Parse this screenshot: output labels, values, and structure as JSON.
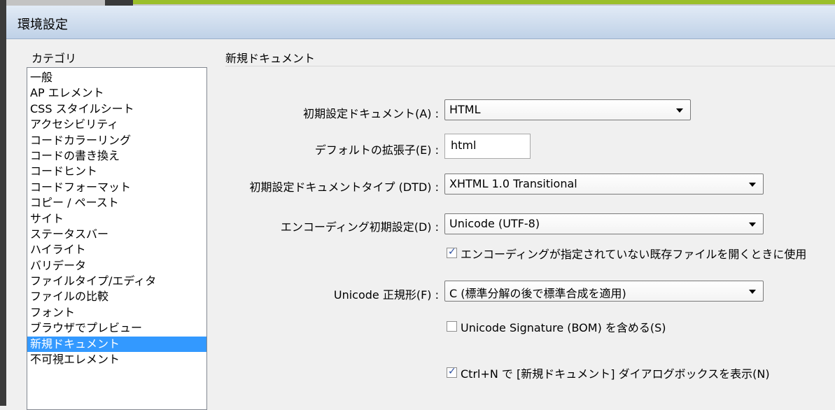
{
  "window": {
    "title": "環境設定"
  },
  "category": {
    "label": "カテゴリ",
    "items": [
      "一般",
      "AP エレメント",
      "CSS スタイルシート",
      "アクセシビリティ",
      "コードカラーリング",
      "コードの書き換え",
      "コードヒント",
      "コードフォーマット",
      "コピー / ペースト",
      "サイト",
      "ステータスバー",
      "ハイライト",
      "バリデータ",
      "ファイルタイプ/エディタ",
      "ファイルの比較",
      "フォント",
      "ブラウザでプレビュー",
      "新規ドキュメント",
      "不可視エレメント"
    ],
    "selected": "新規ドキュメント"
  },
  "section": {
    "title": "新規ドキュメント"
  },
  "form": {
    "default_document": {
      "label": "初期設定ドキュメント(A) :",
      "value": "HTML"
    },
    "default_extension": {
      "label": "デフォルトの拡張子(E) :",
      "value": "html"
    },
    "default_doctype": {
      "label": "初期設定ドキュメントタイプ (DTD) :",
      "value": "XHTML 1.0 Transitional"
    },
    "default_encoding": {
      "label": "エンコーディング初期設定(D) :",
      "value": "Unicode (UTF-8)"
    },
    "use_encoding_for_existing": {
      "label": "エンコーディングが指定されていない既存ファイルを開くときに使用",
      "checked": true
    },
    "unicode_normalization": {
      "label": "Unicode 正規形(F) :",
      "value": "C (標準分解の後で標準合成を適用)"
    },
    "include_bom": {
      "label": "Unicode Signature (BOM) を含める(S)",
      "checked": false
    },
    "show_new_doc_dialog": {
      "label": "Ctrl+N で [新規ドキュメント] ダイアログボックスを表示(N)",
      "checked": true
    }
  },
  "icons": {
    "checkmark": "check-icon",
    "dropdown": "chevron-down-icon"
  }
}
